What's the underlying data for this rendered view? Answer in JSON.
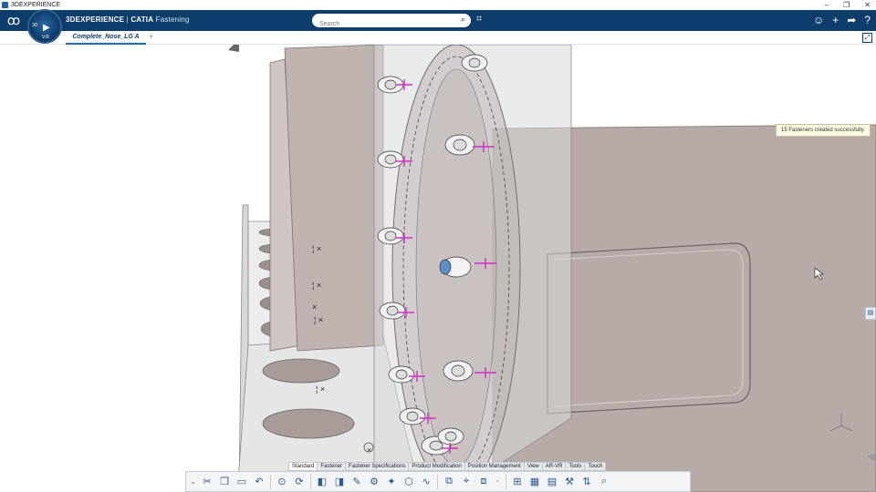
{
  "window": {
    "app_name": "3DEXPERIENCE",
    "controls": {
      "minimize": "–",
      "restore": "❐",
      "close": "✕"
    }
  },
  "header": {
    "brand_prefix": "3DEXPERIENCE",
    "brand_separator": " | ",
    "brand_product": "CATIA",
    "brand_app": "Fastening",
    "search_placeholder": "Search",
    "accent_color": "#0d3d6b"
  },
  "compass": {
    "version_label": "V.R"
  },
  "tabs": [
    {
      "label": "Complete_Nose_LG A",
      "active": true
    }
  ],
  "notification": {
    "text": "15 Fasteners created successfully."
  },
  "workbench_tabs": [
    {
      "label": "Standard",
      "active": true
    },
    {
      "label": "Fastener",
      "active": false
    },
    {
      "label": "Fastener Specifications",
      "active": false
    },
    {
      "label": "Product Modification",
      "active": false
    },
    {
      "label": "Position Management",
      "active": false
    },
    {
      "label": "View",
      "active": false
    },
    {
      "label": "AR-VR",
      "active": false
    },
    {
      "label": "Tools",
      "active": false
    },
    {
      "label": "Touch",
      "active": false
    }
  ],
  "action_bar": {
    "icons": [
      "cut-icon",
      "copy-icon",
      "paste-icon",
      "undo-icon",
      "fit-all-icon",
      "rotate-icon",
      "part-icon",
      "assembly-icon",
      "sketch-icon",
      "fastener-icon",
      "spot-weld-icon",
      "bolt-icon",
      "curve-fastener-icon",
      "fastener-spec-icon",
      "position-icon",
      "duplicate-icon",
      "table-icon",
      "grid-icon",
      "tree-icon",
      "settings-icon",
      "reorder-icon"
    ]
  }
}
